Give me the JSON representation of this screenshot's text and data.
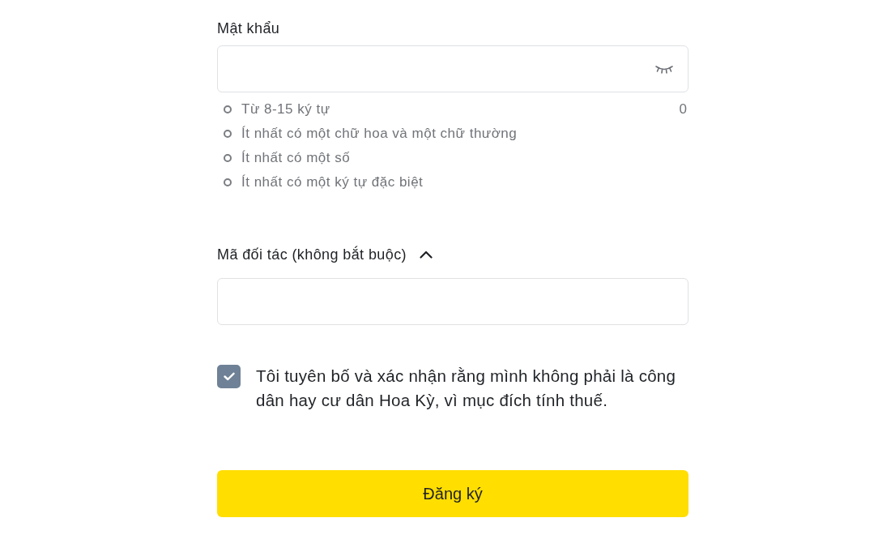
{
  "password": {
    "label": "Mật khẩu",
    "counter": "0",
    "rules": [
      {
        "text": "Từ 8-15 ký tự",
        "met": false
      },
      {
        "text": "Ít nhất có một chữ hoa và một chữ thường",
        "met": false
      },
      {
        "text": "Ít nhất có một số",
        "met": false
      },
      {
        "text": "Ít nhất có một ký tự đặc biệt",
        "met": false
      }
    ]
  },
  "partner_code": {
    "label": "Mã đối tác (không bắt buộc)",
    "expanded": true
  },
  "declaration": {
    "text": "Tôi tuyên bố và xác nhận rằng mình không phải là công dân hay cư dân Hoa Kỳ, vì mục đích tính thuế.",
    "checked": true
  },
  "submit_button": {
    "label": "Đăng ký"
  }
}
